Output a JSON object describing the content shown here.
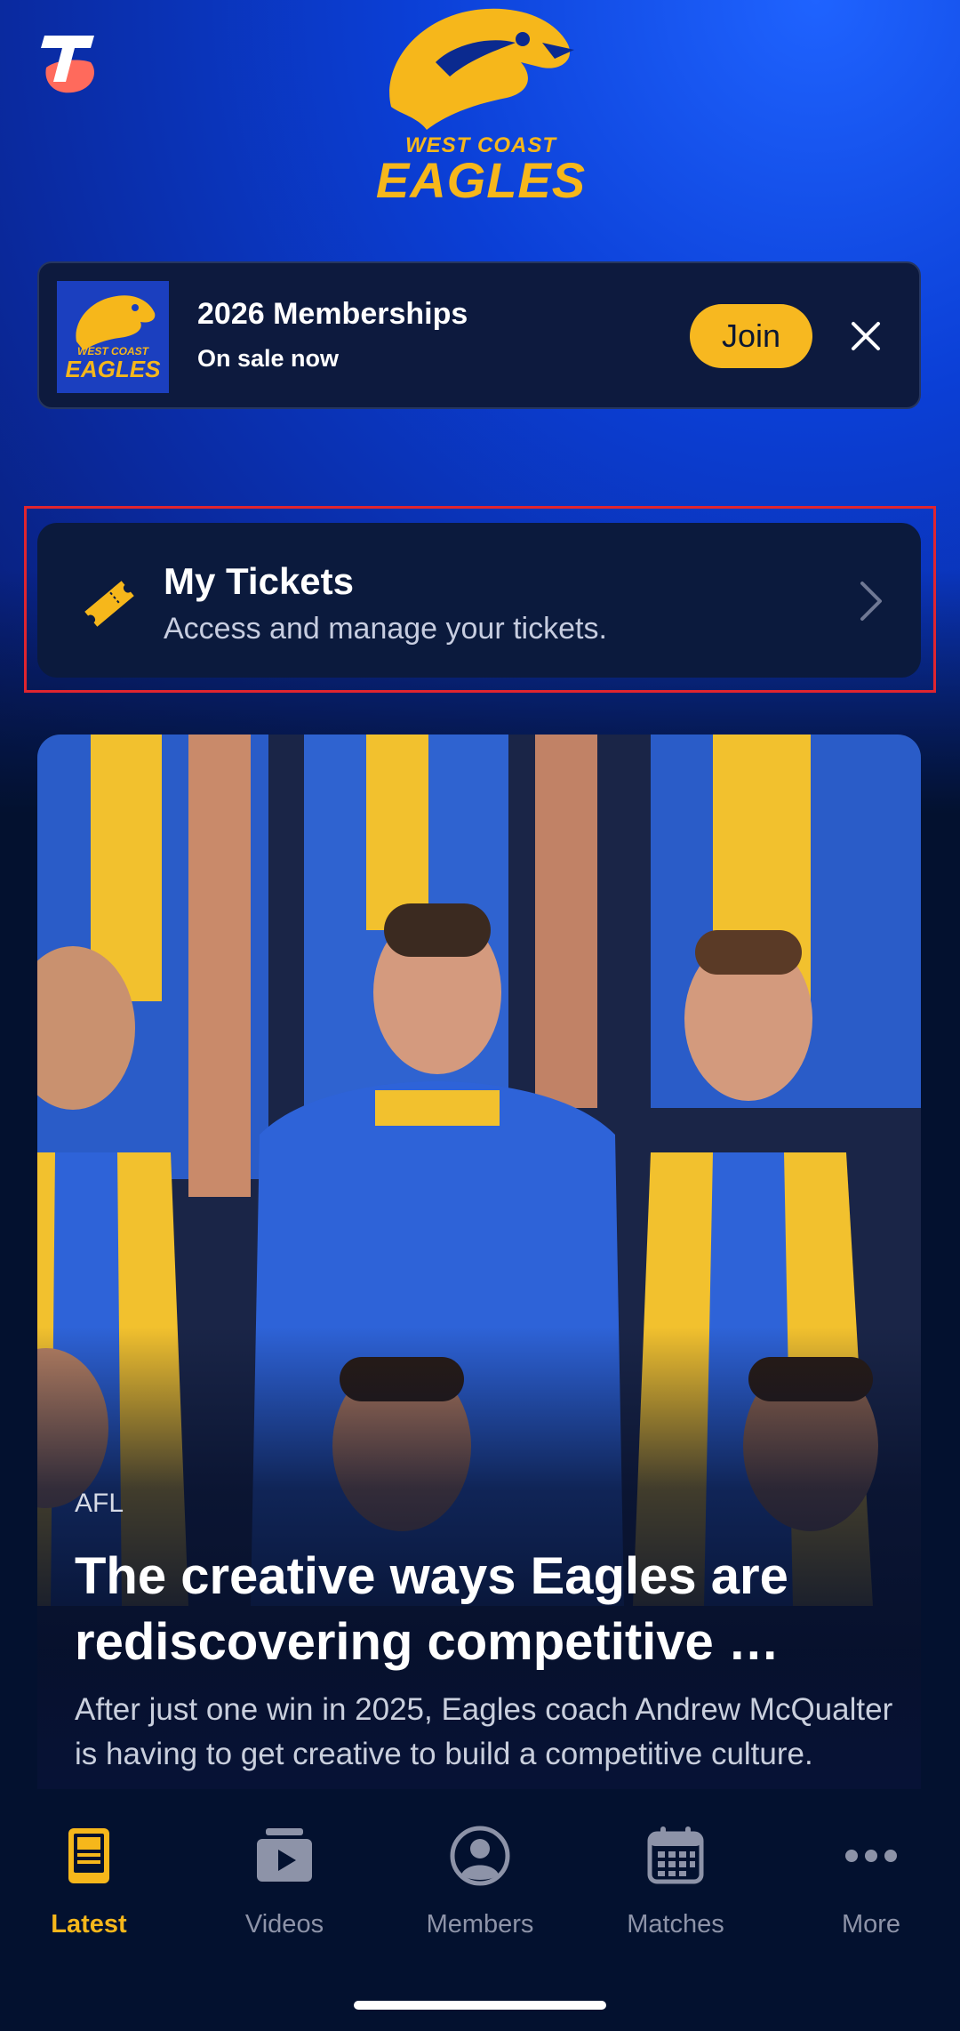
{
  "header": {
    "sponsor_logo": "telstra-logo",
    "club_logo_line1": "WEST COAST",
    "club_logo_line2": "EAGLES"
  },
  "membership_banner": {
    "thumb_line1": "WEST COAST",
    "thumb_line2": "EAGLES",
    "title": "2026 Memberships",
    "subtitle": "On sale now",
    "join_label": "Join",
    "close_icon": "close-icon"
  },
  "tickets": {
    "title": "My Tickets",
    "subtitle": "Access and manage your tickets.",
    "icon": "ticket-icon"
  },
  "article": {
    "tag": "AFL",
    "title": "The creative ways Eagles are rediscovering competitive …",
    "summary": "After just one win in 2025, Eagles coach Andrew McQualter is having to get creative to build a competitive culture."
  },
  "bottom_nav": {
    "items": [
      {
        "label": "Latest",
        "icon": "tablet-icon",
        "active": true
      },
      {
        "label": "Videos",
        "icon": "video-icon",
        "active": false
      },
      {
        "label": "Members",
        "icon": "person-icon",
        "active": false
      },
      {
        "label": "Matches",
        "icon": "calendar-icon",
        "active": false
      },
      {
        "label": "More",
        "icon": "more-icon",
        "active": false
      }
    ]
  },
  "colors": {
    "accent": "#f6b71b",
    "highlight": "#e0252f",
    "background": "#03112f"
  }
}
